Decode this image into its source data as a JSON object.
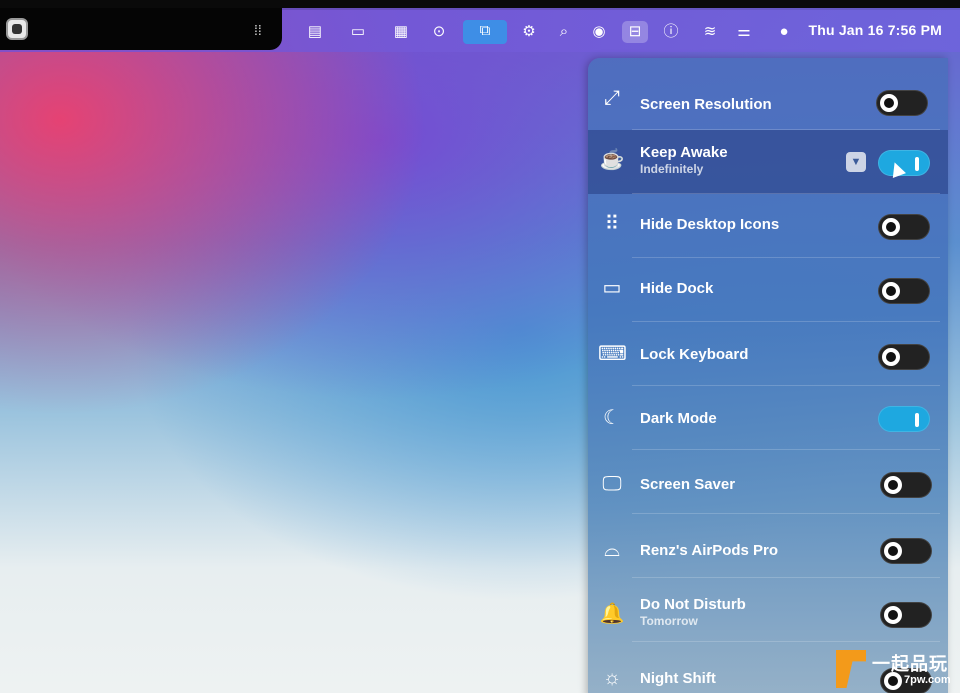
{
  "menubar": {
    "clock": "Thu Jan 16  7:56 PM",
    "icons": [
      "app-logo-icon",
      "split-handle-icon",
      "window-icon",
      "battery-icon",
      "layout-icon",
      "play-icon",
      "display-icon",
      "gear-icon",
      "search-icon",
      "record-icon",
      "panel-toggle-icon",
      "info-icon",
      "wifi-icon",
      "control-center-icon",
      "avatar-icon"
    ]
  },
  "panel": {
    "rows": [
      {
        "icon": "screen-resolution-icon",
        "label": "Screen Resolution",
        "sub": "",
        "on": false
      },
      {
        "icon": "coffee-cup-icon",
        "label": "Keep Awake",
        "sub": "Indefinitely",
        "on": true
      },
      {
        "icon": "grid-icon",
        "label": "Hide Desktop Icons",
        "sub": "",
        "on": false
      },
      {
        "icon": "dock-icon",
        "label": "Hide Dock",
        "sub": "",
        "on": false
      },
      {
        "icon": "keyboard-icon",
        "label": "Lock Keyboard",
        "sub": "",
        "on": false
      },
      {
        "icon": "moon-icon",
        "label": "Dark Mode",
        "sub": "",
        "on": true
      },
      {
        "icon": "monitor-icon",
        "label": "Screen Saver",
        "sub": "",
        "on": false
      },
      {
        "icon": "airpods-icon",
        "label": "Renz's AirPods Pro",
        "sub": "",
        "on": false
      },
      {
        "icon": "bell-icon",
        "label": "Do Not Disturb",
        "sub": "Tomorrow",
        "on": false
      },
      {
        "icon": "lamp-icon",
        "label": "Night Shift",
        "sub": "",
        "on": false
      }
    ]
  },
  "watermark": {
    "cn": "一起品玩",
    "url": "7pw.com"
  }
}
